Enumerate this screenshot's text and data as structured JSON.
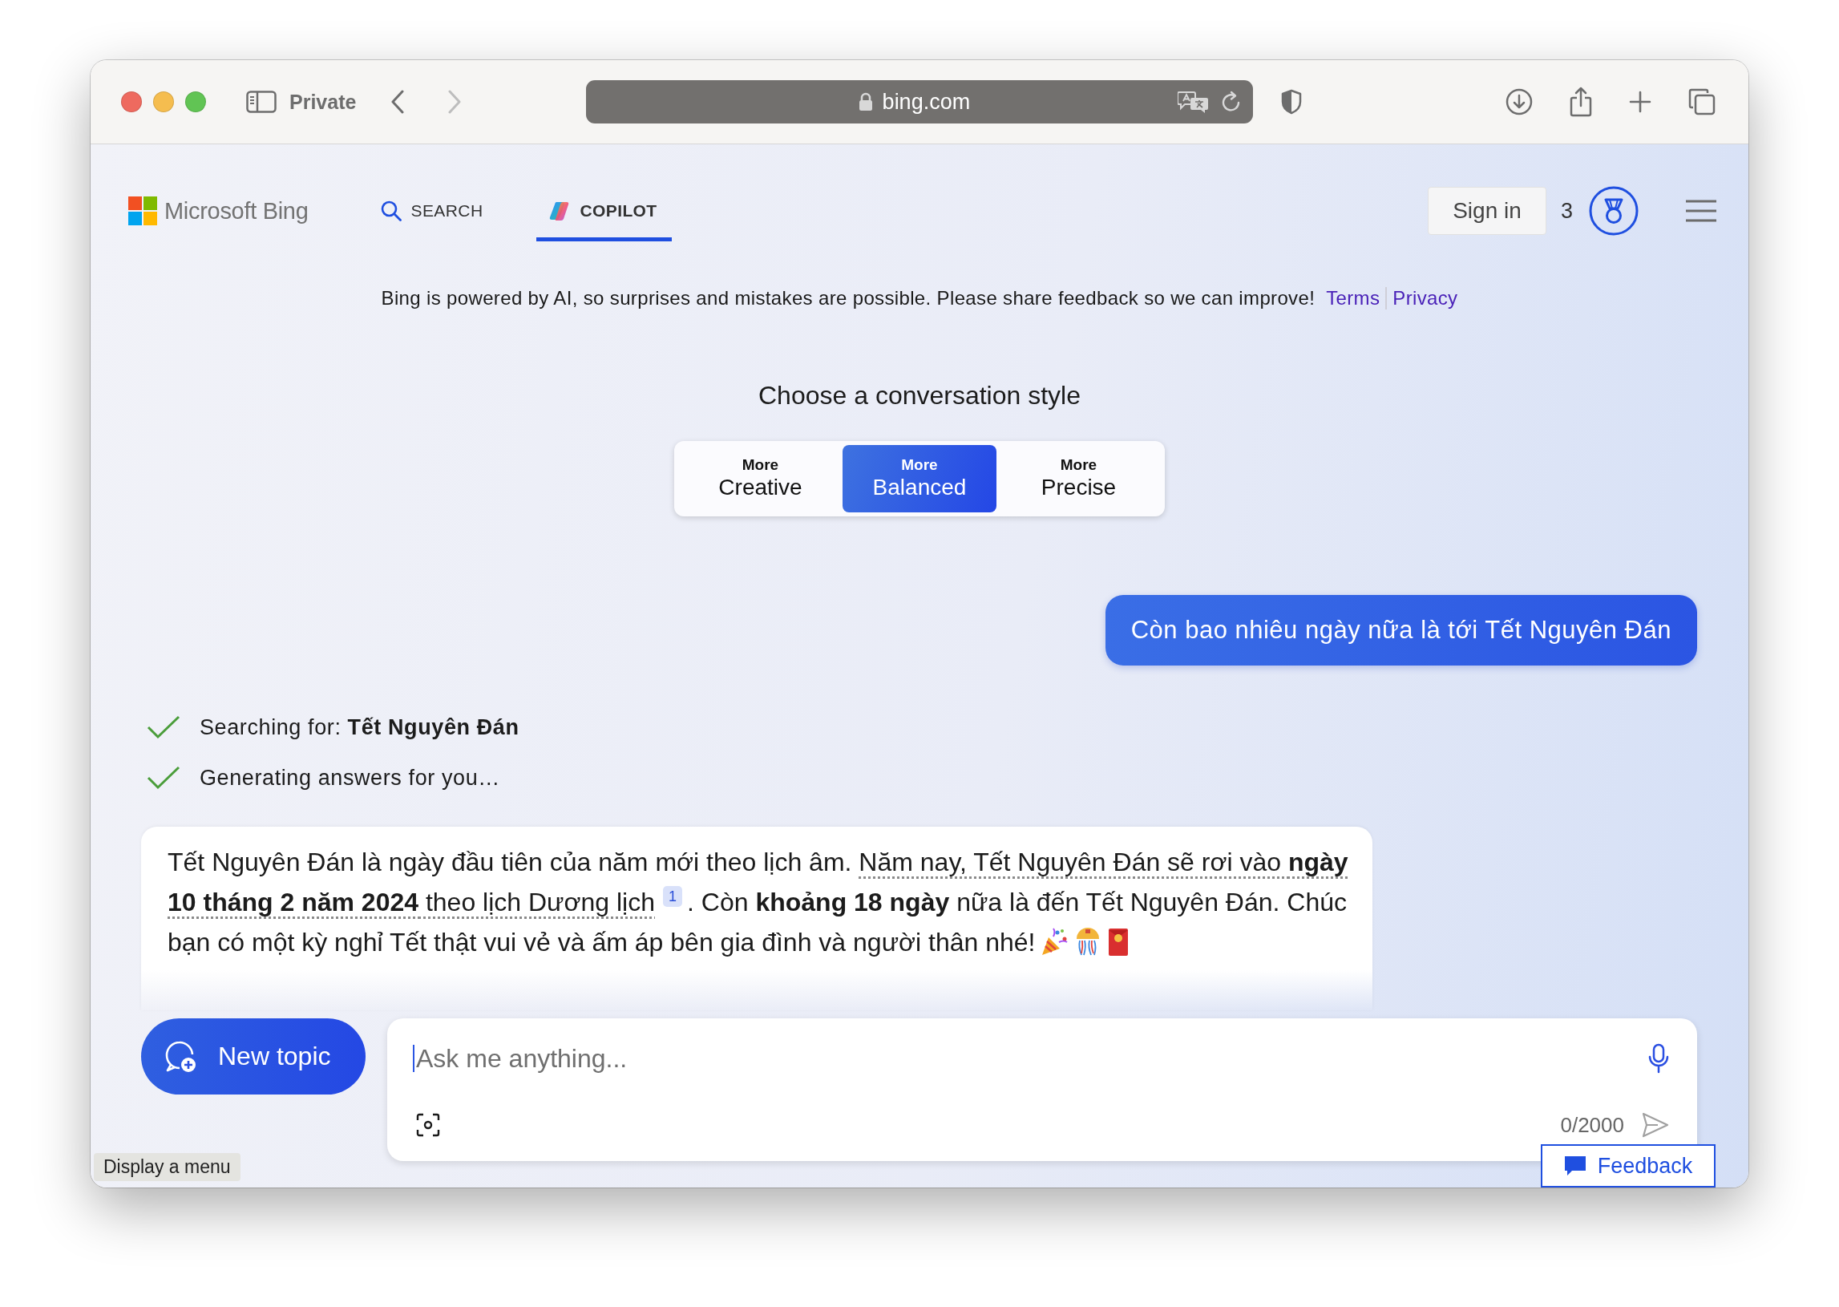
{
  "browser": {
    "private_label": "Private",
    "address": "bing.com",
    "back_disabled": false,
    "forward_disabled": true
  },
  "header": {
    "brand": "Microsoft Bing",
    "nav": [
      {
        "kind": "search",
        "label": "SEARCH",
        "selected": false
      },
      {
        "kind": "copilot",
        "label": "COPILOT",
        "selected": true
      }
    ],
    "sign_in": "Sign in",
    "rewards_count": "3"
  },
  "notice": {
    "text": "Bing is powered by AI, so surprises and mistakes are possible. Please share feedback so we can improve!",
    "links": [
      "Terms",
      "Privacy"
    ]
  },
  "style_picker": {
    "title": "Choose a conversation style",
    "options": [
      {
        "prefix": "More",
        "label": "Creative",
        "selected": false
      },
      {
        "prefix": "More",
        "label": "Balanced",
        "selected": true
      },
      {
        "prefix": "More",
        "label": "Precise",
        "selected": false
      }
    ]
  },
  "chat": {
    "user_message": "Còn bao nhiêu ngày nữa là tới Tết Nguyên Đán",
    "steps": [
      {
        "text": "Searching for: **Tết Nguyên Đán**",
        "done": true
      },
      {
        "text": "Generating answers for you…",
        "done": true
      }
    ],
    "answer": [
      {
        "kind": "text",
        "text": "Tết Nguyên Đán là ngày đầu tiên của năm mới theo lịch âm. "
      },
      {
        "kind": "cited",
        "text": "Năm nay, Tết Nguyên Đán sẽ rơi vào **ngày 10 tháng 2 năm 2024** theo lịch Dương lịch"
      },
      {
        "kind": "citation",
        "text": "1"
      },
      {
        "kind": "text",
        "text": ". Còn **khoảng 18 ngày** nữa là đến Tết Nguyên Đán. Chúc bạn có một kỳ nghỉ Tết thật vui vẻ và ấm áp bên gia đình và người thân nhé!"
      }
    ]
  },
  "composer": {
    "new_topic": "New topic",
    "placeholder": "Ask me anything...",
    "char_count": "0/2000"
  },
  "tooltip": "Display a menu",
  "feedback": "Feedback"
}
